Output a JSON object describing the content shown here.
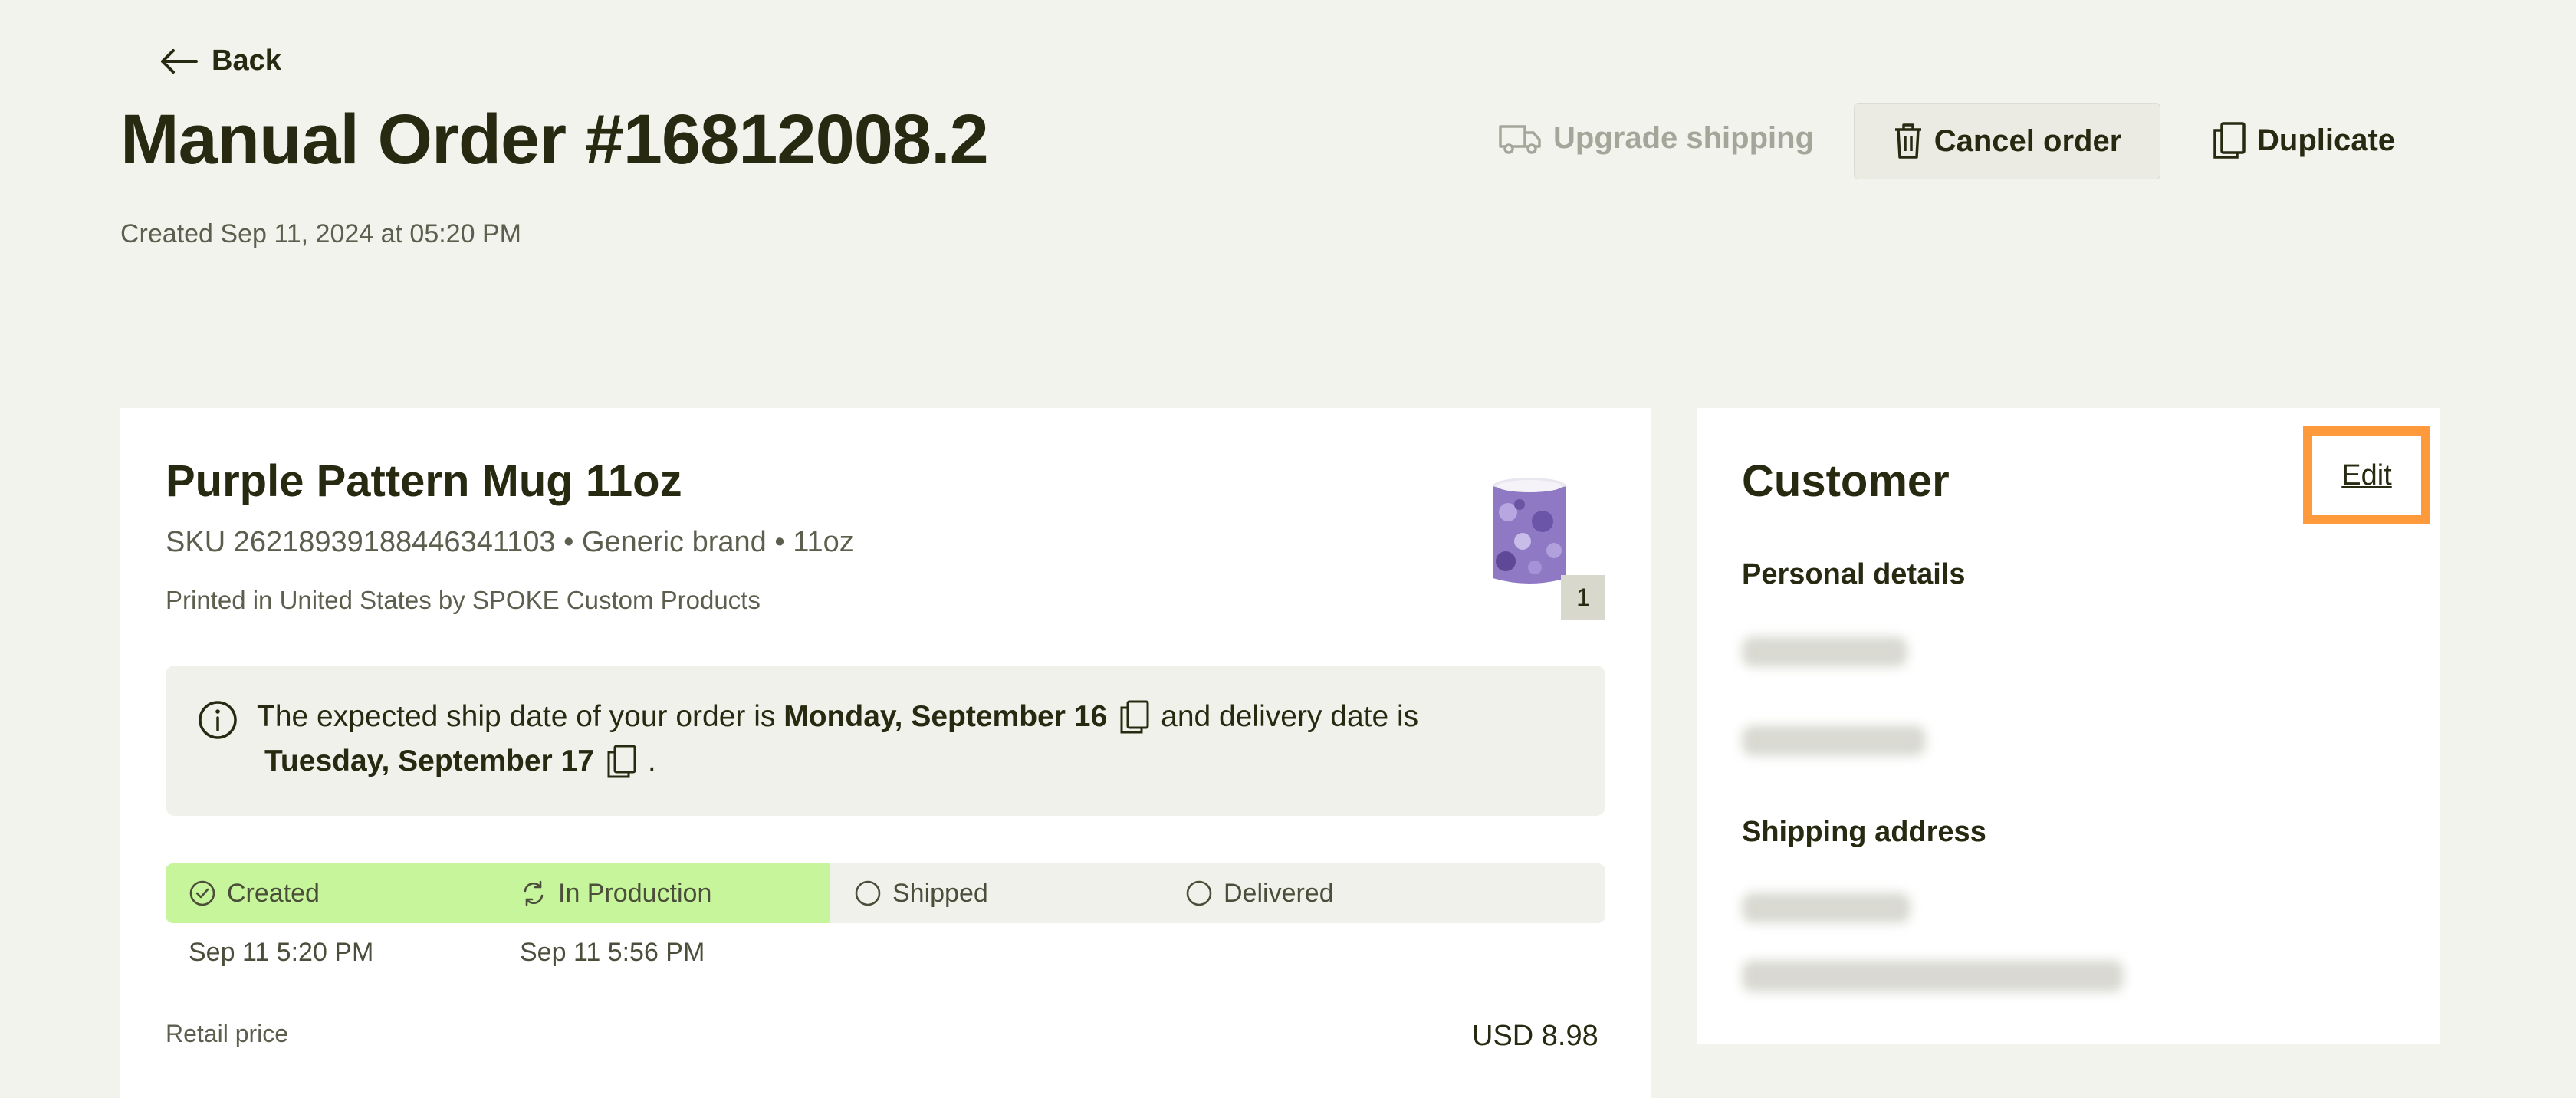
{
  "header": {
    "back_label": "Back",
    "title": "Manual Order #16812008.2",
    "created": "Created Sep 11, 2024 at 05:20 PM",
    "actions": {
      "upgrade_shipping": "Upgrade shipping",
      "cancel_order": "Cancel order",
      "duplicate": "Duplicate"
    }
  },
  "product": {
    "title": "Purple Pattern Mug 11oz",
    "sku_line": "SKU 26218939188446341103  • Generic brand • 11oz",
    "printed_by": "Printed in United States by SPOKE Custom Products",
    "quantity": "1",
    "thumbnail_icon": "purple-mug-thumbnail"
  },
  "info": {
    "line1_prefix": "The expected ship date of your order is",
    "ship_date": "Monday, September 16",
    "line1_suffix": "and delivery date is",
    "delivery_date": "Tuesday, September 17",
    "line2_suffix": "."
  },
  "status": {
    "steps": [
      {
        "label": "Created",
        "date": "Sep 11 5:20 PM",
        "state": "done",
        "icon": "check-circle-icon"
      },
      {
        "label": "In Production",
        "date": "Sep 11 5:56 PM",
        "state": "active",
        "icon": "refresh-icon"
      },
      {
        "label": "Shipped",
        "date": "",
        "state": "pending",
        "icon": "empty-circle-icon"
      },
      {
        "label": "Delivered",
        "date": "",
        "state": "pending",
        "icon": "empty-circle-icon"
      }
    ],
    "colors": {
      "done_bg": "#c7f59b",
      "pending_bg": "#f1f1ec"
    }
  },
  "pricing": {
    "retail_label": "Retail price",
    "retail_value": "USD 8.98"
  },
  "customer": {
    "title": "Customer",
    "edit_label": "Edit",
    "personal_details_heading": "Personal details",
    "shipping_address_heading": "Shipping address"
  },
  "colors": {
    "page_bg": "#f3f3ee",
    "text_dark": "#272a10",
    "highlight_border": "#ff9a3c"
  }
}
